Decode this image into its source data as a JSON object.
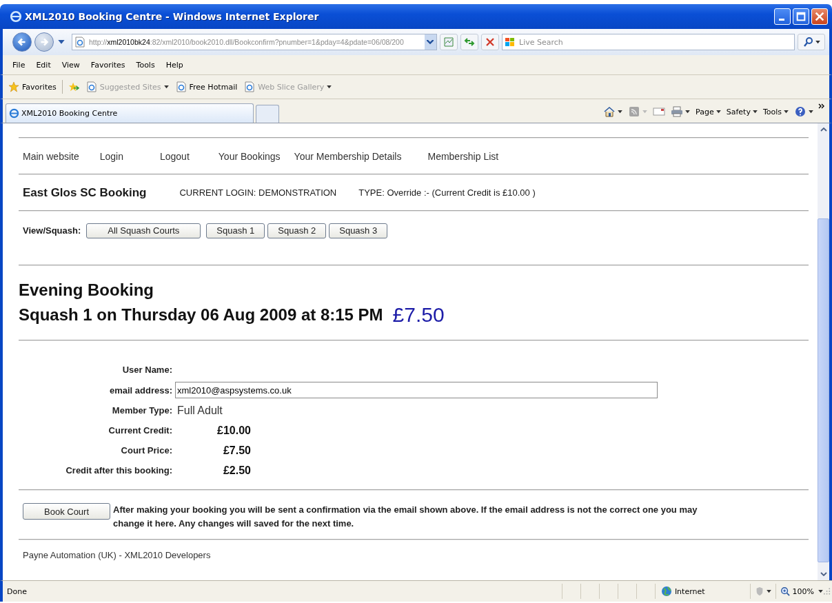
{
  "window": {
    "title": "XML2010 Booking Centre - Windows Internet Explorer"
  },
  "address_bar": {
    "scheme": "http://",
    "host": "xml2010bk24",
    "rest": ":82/xml2010/book2010.dll/Bookconfirm?pnumber=1&pday=4&pdate=06/08/200"
  },
  "search": {
    "placeholder": "Live Search"
  },
  "menu": [
    "File",
    "Edit",
    "View",
    "Favorites",
    "Tools",
    "Help"
  ],
  "favorites_bar": {
    "label": "Favorites",
    "links": [
      {
        "label": "Suggested Sites",
        "dropdown": true,
        "dimmed": true
      },
      {
        "label": "Free Hotmail",
        "dropdown": false,
        "dimmed": false
      },
      {
        "label": "Web Slice Gallery",
        "dropdown": true,
        "dimmed": true
      }
    ]
  },
  "tabs": [
    {
      "label": "XML2010 Booking Centre",
      "selected": true
    }
  ],
  "command_bar": [
    "Page",
    "Safety",
    "Tools"
  ],
  "nav": [
    "Main website",
    "Login",
    "Logout",
    "Your Bookings",
    "Your Membership Details",
    "Membership List"
  ],
  "header": {
    "club": "East Glos SC Booking",
    "login": "CURRENT LOGIN:  DEMONSTRATION",
    "type": "TYPE: Override :- (Current Credit is £10.00 )"
  },
  "view": {
    "label": "View/Squash:",
    "buttons": [
      "All Squash Courts",
      "Squash 1",
      "Squash 2",
      "Squash 3"
    ]
  },
  "booking": {
    "title": "Evening Booking",
    "court_line": "Squash 1 on Thursday 06 Aug 2009 at 8:15 PM",
    "price": "£7.50"
  },
  "form": {
    "user_name_label": "User Name:",
    "email_label": "email address:",
    "email": "xml2010@aspsystems.co.uk",
    "rows": [
      {
        "label": "Member Type:",
        "value": "Full Adult",
        "kind": "plain"
      },
      {
        "label": "Current Credit:",
        "value": "£10.00",
        "kind": "money"
      },
      {
        "label": "Court Price:",
        "value": "£7.50",
        "kind": "money"
      },
      {
        "label": "Credit after this booking:",
        "value": "£2.50",
        "kind": "money"
      }
    ]
  },
  "submit": "Book Court",
  "notice": "After making your booking you will be sent a confirmation via the email shown above. If the email address is not the correct one you may change it here. Any changes will saved for the next time.",
  "footer": "Payne Automation (UK) - XML2010 Developers",
  "status_bar": {
    "text": "Done",
    "zone": "Internet",
    "zoom": "100%"
  }
}
